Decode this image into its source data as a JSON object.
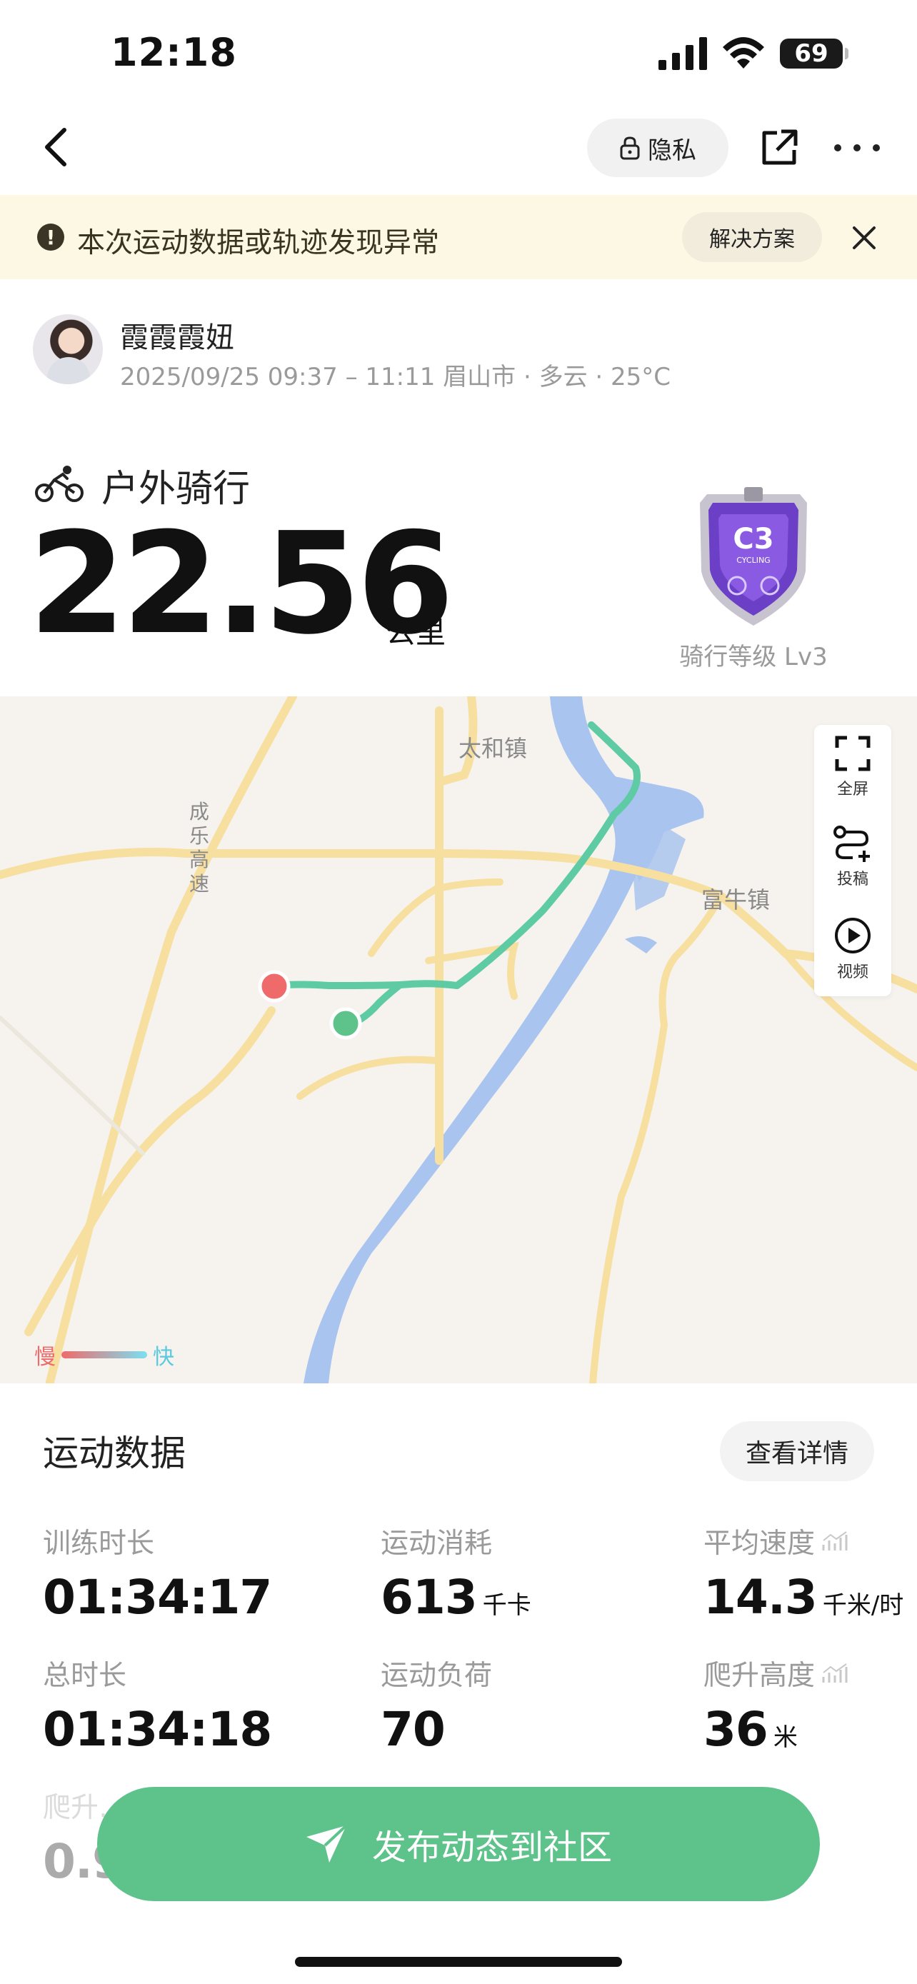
{
  "status_bar": {
    "time": "12:18",
    "battery": "69"
  },
  "nav": {
    "privacy_label": "隐私"
  },
  "warning": {
    "text": "本次运动数据或轨迹发现异常",
    "action_label": "解决方案"
  },
  "user": {
    "name": "霞霞霞妞",
    "meta": "2025/09/25 09:37 – 11:11 眉山市 · 多云 · 25°C"
  },
  "activity": {
    "type": "户外骑行",
    "distance": "22.56",
    "distance_unit": "公里",
    "badge_text": "C3",
    "badge_sub": "CYCLING",
    "badge_label": "骑行等级 Lv3"
  },
  "map": {
    "labels": {
      "town1": "太和镇",
      "town2": "富牛镇",
      "highway": [
        "成",
        "乐",
        "高",
        "速"
      ]
    },
    "tools": [
      "全屏",
      "投稿",
      "视频"
    ],
    "legend": {
      "slow": "慢",
      "fast": "快"
    },
    "colors": {
      "route": "#5fcba4",
      "start": "#5ec38b",
      "end": "#ef6b6b",
      "river": "#a9c4ef",
      "road": "#f7dfa0"
    }
  },
  "data_section": {
    "title": "运动数据",
    "detail_label": "查看详情",
    "stats": [
      {
        "label": "训练时长",
        "value": "01:34:17",
        "unit": ""
      },
      {
        "label": "运动消耗",
        "value": "613",
        "unit": "千卡"
      },
      {
        "label": "平均速度",
        "value": "14.3",
        "unit": "千米/时"
      },
      {
        "label": "总时长",
        "value": "01:34:18",
        "unit": ""
      },
      {
        "label": "运动负荷",
        "value": "70",
        "unit": ""
      },
      {
        "label": "爬升高度",
        "value": "36",
        "unit": "米"
      },
      {
        "label": "爬升…",
        "value": "0.9",
        "unit": ""
      }
    ]
  },
  "cta": {
    "label": "发布动态到社区"
  }
}
